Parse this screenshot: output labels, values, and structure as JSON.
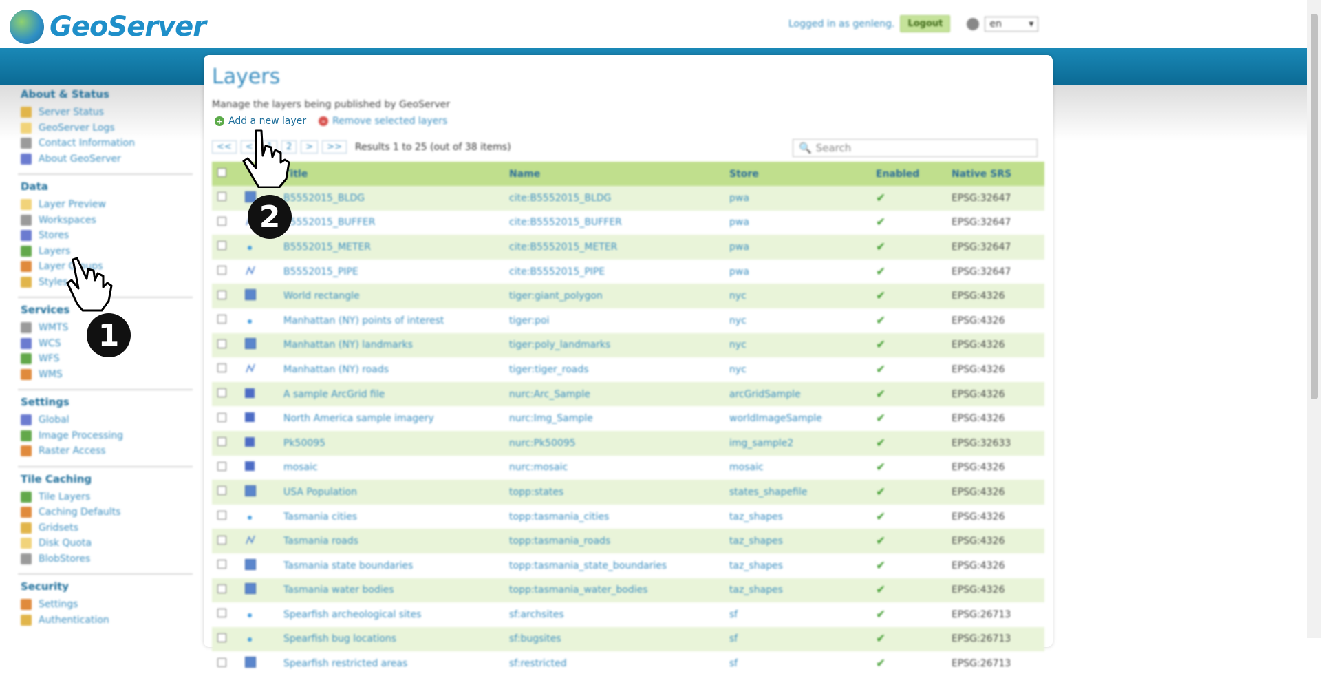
{
  "header": {
    "app_name": "GeoServer",
    "logged_in_text": "Logged in as genleng.",
    "logout_label": "Logout",
    "language": "en"
  },
  "sidebar": {
    "sections": [
      {
        "title": "About & Status",
        "items": [
          "Server Status",
          "GeoServer Logs",
          "Contact Information",
          "About GeoServer"
        ]
      },
      {
        "title": "Data",
        "items": [
          "Layer Preview",
          "Workspaces",
          "Stores",
          "Layers",
          "Layer Groups",
          "Styles"
        ]
      },
      {
        "title": "Services",
        "items": [
          "WMTS",
          "WCS",
          "WFS",
          "WMS"
        ]
      },
      {
        "title": "Settings",
        "items": [
          "Global",
          "Image Processing",
          "Raster Access"
        ]
      },
      {
        "title": "Tile Caching",
        "items": [
          "Tile Layers",
          "Caching Defaults",
          "Gridsets",
          "Disk Quota",
          "BlobStores"
        ]
      },
      {
        "title": "Security",
        "items": [
          "Settings",
          "Authentication"
        ]
      }
    ],
    "colors": [
      "#e1b54a",
      "#f1d37a",
      "#9a9a9a",
      "#6b7bd0",
      "#62a84a",
      "#e08a3c"
    ]
  },
  "main": {
    "title": "Layers",
    "description": "Manage the layers being published by GeoServer",
    "add_label": "Add a new layer",
    "remove_label": "Remove selected layers",
    "pager": {
      "first": "<<",
      "prev": "<",
      "page1": "1",
      "page2": "2",
      "next": ">",
      "last": ">>",
      "results": "Results 1 to 25 (out of 38 items)"
    },
    "search_placeholder": "Search",
    "columns": [
      "Title",
      "Name",
      "Store",
      "Enabled",
      "Native SRS"
    ],
    "rows": [
      {
        "type": "polygon",
        "title": "B5552015_BLDG",
        "name": "cite:B5552015_BLDG",
        "store": "pwa",
        "srs": "EPSG:32647"
      },
      {
        "type": "line",
        "title": "B5552015_BUFFER",
        "name": "cite:B5552015_BUFFER",
        "store": "pwa",
        "srs": "EPSG:32647"
      },
      {
        "type": "point",
        "title": "B5552015_METER",
        "name": "cite:B5552015_METER",
        "store": "pwa",
        "srs": "EPSG:32647"
      },
      {
        "type": "line",
        "title": "B5552015_PIPE",
        "name": "cite:B5552015_PIPE",
        "store": "pwa",
        "srs": "EPSG:32647"
      },
      {
        "type": "polygon",
        "title": "World rectangle",
        "name": "tiger:giant_polygon",
        "store": "nyc",
        "srs": "EPSG:4326"
      },
      {
        "type": "point",
        "title": "Manhattan (NY) points of interest",
        "name": "tiger:poi",
        "store": "nyc",
        "srs": "EPSG:4326"
      },
      {
        "type": "polygon",
        "title": "Manhattan (NY) landmarks",
        "name": "tiger:poly_landmarks",
        "store": "nyc",
        "srs": "EPSG:4326"
      },
      {
        "type": "line",
        "title": "Manhattan (NY) roads",
        "name": "tiger:tiger_roads",
        "store": "nyc",
        "srs": "EPSG:4326"
      },
      {
        "type": "raster",
        "title": "A sample ArcGrid file",
        "name": "nurc:Arc_Sample",
        "store": "arcGridSample",
        "srs": "EPSG:4326"
      },
      {
        "type": "raster",
        "title": "North America sample imagery",
        "name": "nurc:Img_Sample",
        "store": "worldImageSample",
        "srs": "EPSG:4326"
      },
      {
        "type": "raster",
        "title": "Pk50095",
        "name": "nurc:Pk50095",
        "store": "img_sample2",
        "srs": "EPSG:32633"
      },
      {
        "type": "raster",
        "title": "mosaic",
        "name": "nurc:mosaic",
        "store": "mosaic",
        "srs": "EPSG:4326"
      },
      {
        "type": "polygon",
        "title": "USA Population",
        "name": "topp:states",
        "store": "states_shapefile",
        "srs": "EPSG:4326"
      },
      {
        "type": "point",
        "title": "Tasmania cities",
        "name": "topp:tasmania_cities",
        "store": "taz_shapes",
        "srs": "EPSG:4326"
      },
      {
        "type": "line",
        "title": "Tasmania roads",
        "name": "topp:tasmania_roads",
        "store": "taz_shapes",
        "srs": "EPSG:4326"
      },
      {
        "type": "polygon",
        "title": "Tasmania state boundaries",
        "name": "topp:tasmania_state_boundaries",
        "store": "taz_shapes",
        "srs": "EPSG:4326"
      },
      {
        "type": "polygon",
        "title": "Tasmania water bodies",
        "name": "topp:tasmania_water_bodies",
        "store": "taz_shapes",
        "srs": "EPSG:4326"
      },
      {
        "type": "point",
        "title": "Spearfish archeological sites",
        "name": "sf:archsites",
        "store": "sf",
        "srs": "EPSG:26713"
      },
      {
        "type": "point",
        "title": "Spearfish bug locations",
        "name": "sf:bugsites",
        "store": "sf",
        "srs": "EPSG:26713"
      },
      {
        "type": "polygon",
        "title": "Spearfish restricted areas",
        "name": "sf:restricted",
        "store": "sf",
        "srs": "EPSG:26713"
      }
    ]
  },
  "annotations": {
    "step1": "1",
    "step2": "2"
  },
  "colors": {
    "accent": "#3a8ec0",
    "header_band": "#1a88b6",
    "table_header": "#c0df8d",
    "row_alt": "#e9f4d9",
    "enabled_check": "#3e9c2d"
  }
}
